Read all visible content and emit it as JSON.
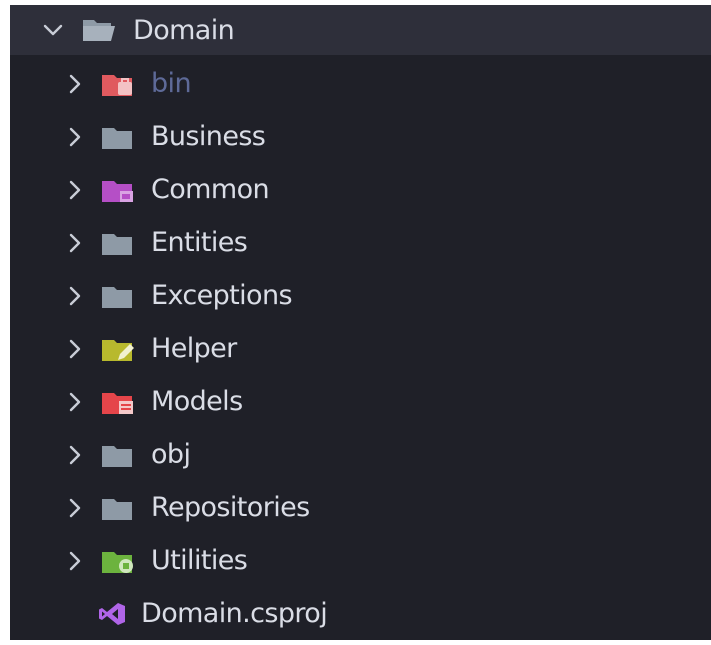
{
  "root": {
    "label": "Domain",
    "expanded": true
  },
  "items": [
    {
      "label": "bin",
      "icon": "folder-bin-icon",
      "color": "#e05a5f",
      "dim": true
    },
    {
      "label": "Business",
      "icon": "folder-icon",
      "color": "#8e9aa6"
    },
    {
      "label": "Common",
      "icon": "folder-common-icon",
      "color": "#b54fc6"
    },
    {
      "label": "Entities",
      "icon": "folder-icon",
      "color": "#8e9aa6"
    },
    {
      "label": "Exceptions",
      "icon": "folder-icon",
      "color": "#8e9aa6"
    },
    {
      "label": "Helper",
      "icon": "folder-helper-icon",
      "color": "#b7b82e"
    },
    {
      "label": "Models",
      "icon": "folder-models-icon",
      "color": "#e5454a"
    },
    {
      "label": "obj",
      "icon": "folder-icon",
      "color": "#8e9aa6"
    },
    {
      "label": "Repositories",
      "icon": "folder-icon",
      "color": "#8e9aa6"
    },
    {
      "label": "Utilities",
      "icon": "folder-utilities-icon",
      "color": "#6cb33e"
    }
  ],
  "file": {
    "label": "Domain.csproj",
    "icon": "visual-studio-icon",
    "color": "#b065e8"
  },
  "colors": {
    "background": "#1f2028",
    "header": "#2e2f3a",
    "text": "#dadde6",
    "dim_text": "#5e6a98"
  }
}
